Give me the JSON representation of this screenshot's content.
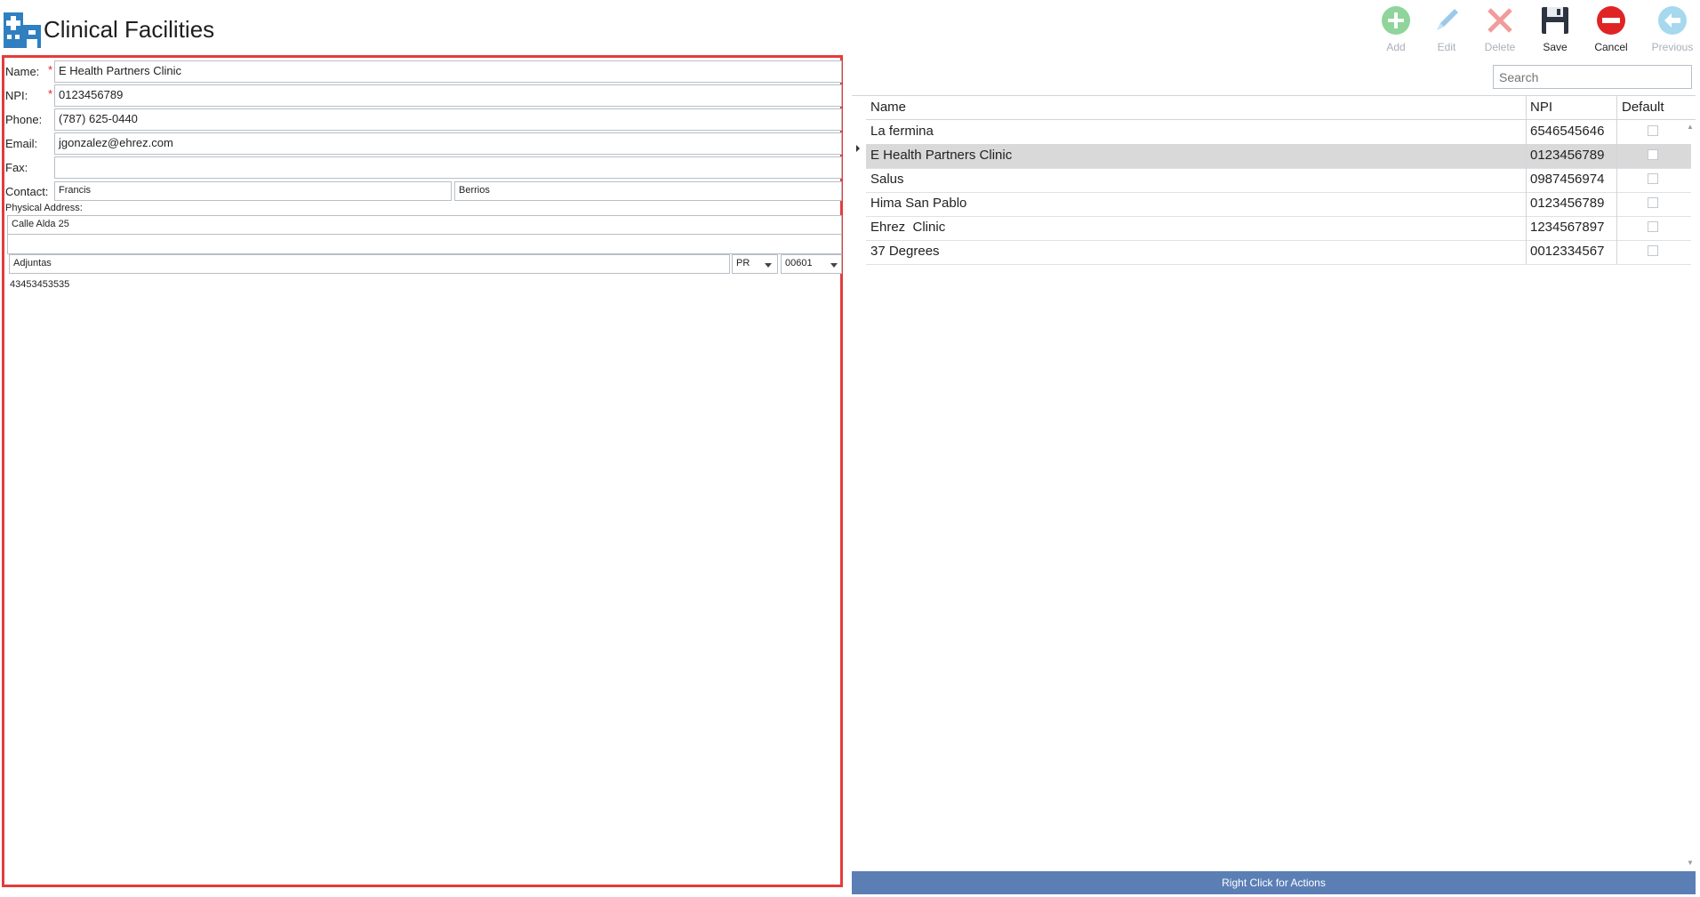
{
  "header": {
    "title": "Clinical Facilities",
    "logo_icon": "hospital-icon"
  },
  "toolbar": [
    {
      "id": "add",
      "label": "Add",
      "icon": "plus-circle-icon",
      "enabled": false,
      "color": "#8fd49a"
    },
    {
      "id": "edit",
      "label": "Edit",
      "icon": "pencil-icon",
      "enabled": false,
      "color": "#9cc9ea"
    },
    {
      "id": "delete",
      "label": "Delete",
      "icon": "x-icon",
      "enabled": false,
      "color": "#f29b9b"
    },
    {
      "id": "save",
      "label": "Save",
      "icon": "floppy-disk-icon",
      "enabled": true,
      "color": "#2d3340"
    },
    {
      "id": "cancel",
      "label": "Cancel",
      "icon": "minus-circle-icon",
      "enabled": true,
      "color": "#e02424"
    },
    {
      "id": "previous",
      "label": "Previous",
      "icon": "arrow-left-circle-icon",
      "enabled": false,
      "color": "#a6d8ee"
    }
  ],
  "form": {
    "name_label": "Name:",
    "name_value": "E Health Partners Clinic",
    "npi_label": "NPI:",
    "npi_value": "0123456789",
    "required_mark": "*",
    "phone_label": "Phone:",
    "phone_value": "(787) 625-0440",
    "email_label": "Email:",
    "email_value": "jgonzalez@ehrez.com",
    "fax_label": "Fax:",
    "fax_value": "",
    "contact_label": "Contact:",
    "contact_first": "Francis",
    "contact_last": "Berrios",
    "address_label": "Physical Address:",
    "address_line1": "Calle Alda 25",
    "address_line2": "",
    "city": "Adjuntas",
    "state": "PR",
    "zip": "00601",
    "extra_value": "43453453535"
  },
  "search": {
    "placeholder": "Search"
  },
  "grid": {
    "columns": [
      "Name",
      "NPI",
      "Default"
    ],
    "rows": [
      {
        "name": "La fermina",
        "npi": "6546545646",
        "default": false,
        "selected": false
      },
      {
        "name": "E Health Partners Clinic",
        "npi": "0123456789",
        "default": false,
        "selected": true
      },
      {
        "name": "Salus",
        "npi": "0987456974",
        "default": false,
        "selected": false
      },
      {
        "name": "Hima San Pablo",
        "npi": "0123456789",
        "default": false,
        "selected": false
      },
      {
        "name": "Ehrez  Clinic",
        "npi": "1234567897",
        "default": false,
        "selected": false
      },
      {
        "name": "37 Degrees",
        "npi": "0012334567",
        "default": false,
        "selected": false
      }
    ]
  },
  "status_bar": {
    "text": "Right Click for Actions"
  },
  "colors": {
    "accent": "#5b7fb5",
    "highlight_border": "#e53b3b",
    "selected_row": "#d9d9d9"
  }
}
